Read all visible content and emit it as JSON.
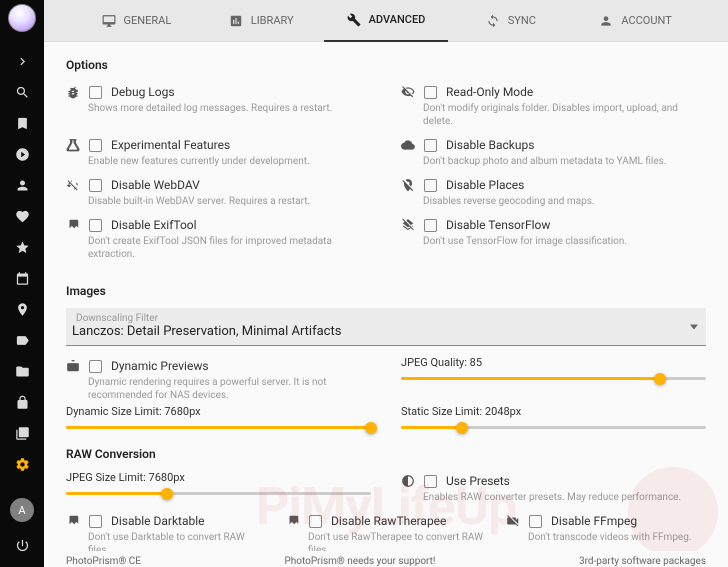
{
  "tabs": [
    {
      "label": "GENERAL"
    },
    {
      "label": "LIBRARY"
    },
    {
      "label": "ADVANCED"
    },
    {
      "label": "SYNC"
    },
    {
      "label": "ACCOUNT"
    }
  ],
  "sections": {
    "options": "Options",
    "images": "Images",
    "raw": "RAW Conversion"
  },
  "options": [
    {
      "label": "Debug Logs",
      "desc": "Shows more detailed log messages. Requires a restart."
    },
    {
      "label": "Read-Only Mode",
      "desc": "Don't modify originals folder. Disables import, upload, and delete."
    },
    {
      "label": "Experimental Features",
      "desc": "Enable new features currently under development."
    },
    {
      "label": "Disable Backups",
      "desc": "Don't backup photo and album metadata to YAML files."
    },
    {
      "label": "Disable WebDAV",
      "desc": "Disable built-in WebDAV server. Requires a restart."
    },
    {
      "label": "Disable Places",
      "desc": "Disables reverse geocoding and maps."
    },
    {
      "label": "Disable ExifTool",
      "desc": "Don't create ExifTool JSON files for improved metadata extraction."
    },
    {
      "label": "Disable TensorFlow",
      "desc": "Don't use TensorFlow for image classification."
    }
  ],
  "images": {
    "filter_label": "Downscaling Filter",
    "filter_value": "Lanczos: Detail Preservation, Minimal Artifacts",
    "dynamic_previews": {
      "label": "Dynamic Previews",
      "desc": "Dynamic rendering requires a powerful server. It is not recommended for NAS devices."
    },
    "jpeg_quality": {
      "label": "JPEG Quality: 85",
      "pct": 85
    },
    "dynamic_limit": {
      "label": "Dynamic Size Limit: 7680px",
      "pct": 100
    },
    "static_limit": {
      "label": "Static Size Limit: 2048px",
      "pct": 20
    }
  },
  "raw": {
    "jpeg_limit": {
      "label": "JPEG Size Limit: 7680px",
      "pct": 33
    },
    "use_presets": {
      "label": "Use Presets",
      "desc": "Enables RAW converter presets. May reduce performance."
    },
    "opts": [
      {
        "label": "Disable Darktable",
        "desc": "Don't use Darktable to convert RAW files."
      },
      {
        "label": "Disable RawTherapee",
        "desc": "Don't use RawTherapee to convert RAW files."
      },
      {
        "label": "Disable FFmpeg",
        "desc": "Don't transcode videos with FFmpeg."
      }
    ]
  },
  "footer": {
    "left": "PhotoPrism® CE",
    "center": "PhotoPrism® needs your support!",
    "right": "3rd-party software packages"
  },
  "avatar": "A",
  "watermark": {
    "a": "PiMyLife",
    "b": "Up"
  }
}
